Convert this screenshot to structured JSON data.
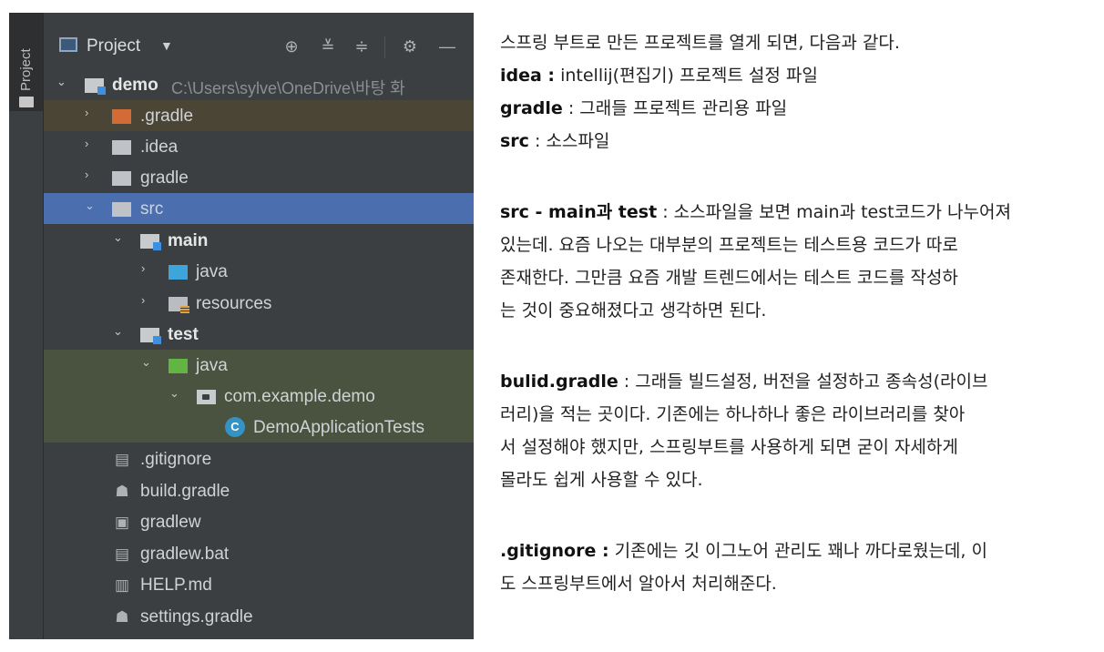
{
  "ide": {
    "side_tab_label": "Project",
    "toolbar": {
      "project_label": "Project"
    },
    "tree": [
      {
        "label": "demo",
        "path": "C:\\Users\\sylve\\OneDrive\\바탕 화",
        "bold": true
      },
      {
        "label": ".gradle"
      },
      {
        "label": ".idea"
      },
      {
        "label": "gradle"
      },
      {
        "label": "src"
      },
      {
        "label": "main",
        "bold": true
      },
      {
        "label": "java"
      },
      {
        "label": "resources"
      },
      {
        "label": "test",
        "bold": true
      },
      {
        "label": "java"
      },
      {
        "label": "com.example.demo"
      },
      {
        "label": "DemoApplicationTests"
      },
      {
        "label": ".gitignore"
      },
      {
        "label": "build.gradle"
      },
      {
        "label": "gradlew"
      },
      {
        "label": "gradlew.bat"
      },
      {
        "label": "HELP.md"
      },
      {
        "label": "settings.gradle"
      }
    ],
    "colors": {
      "panel_bg": "#3c3f41",
      "selected_row": "#4b6eaf",
      "excluded_row": "#4b4536",
      "test_row": "#49533f"
    },
    "icons": [
      "project-view-icon",
      "locate-icon",
      "expand-all-icon",
      "collapse-all-icon",
      "settings-icon",
      "hide-icon"
    ]
  },
  "article": {
    "intro": "스프링 부트로 만든 프로젝트를 열게 되면, 다음과 같다.",
    "idea_term": "idea :",
    "idea_desc": " intellij(편집기) 프로젝트 설정 파일",
    "gradle_term": "gradle",
    "gradle_desc": " : 그래들 프로젝트 관리용 파일",
    "src_term": "src",
    "src_desc": " : 소스파일",
    "srcmt_term": "src - main과 test",
    "srcmt_l1": " : 소스파일을 보면 main과 test코드가 나누어져",
    "srcmt_l2": "있는데. 요즘 나오는 대부분의 프로젝트는 테스트용 코드가 따로",
    "srcmt_l3": "존재한다. 그만큼 요즘 개발 트렌드에서는 테스트 코드를 작성하",
    "srcmt_l4": "는 것이 중요해졌다고 생각하면 된다.",
    "build_term": "bulid.gradle",
    "build_l1": " : 그래들 빌드설정, 버전을 설정하고 종속성(라이브",
    "build_l2": "러리)을 적는 곳이다. 기존에는 하나하나 좋은 라이브러리를 찾아",
    "build_l3": "서 설정해야 했지만, 스프링부트를 사용하게 되면 굳이 자세하게",
    "build_l4": "몰라도 쉽게 사용할 수 있다.",
    "git_term": ".gitignore :",
    "git_l1": " 기존에는 깃 이그노어 관리도 꽤나 까다로웠는데, 이",
    "git_l2": "도 스프링부트에서 알아서 처리해준다."
  }
}
